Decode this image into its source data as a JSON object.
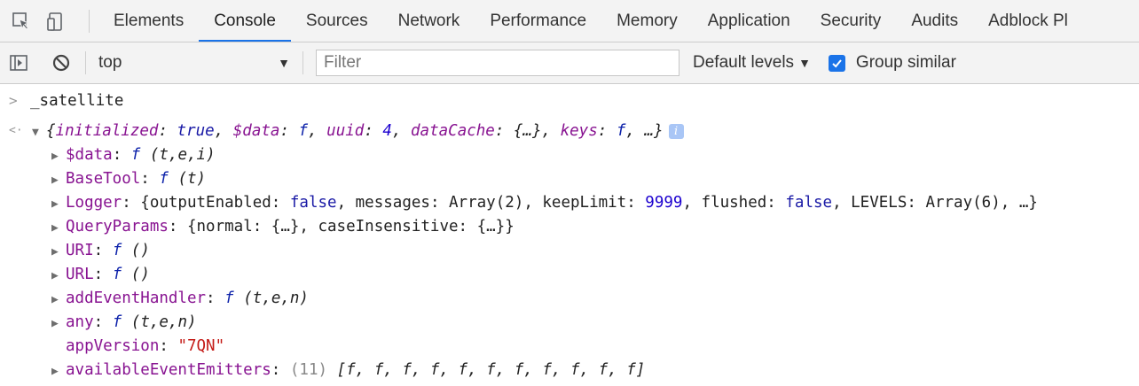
{
  "tabs": [
    {
      "label": "Elements"
    },
    {
      "label": "Console",
      "active": true
    },
    {
      "label": "Sources"
    },
    {
      "label": "Network"
    },
    {
      "label": "Performance"
    },
    {
      "label": "Memory"
    },
    {
      "label": "Application"
    },
    {
      "label": "Security"
    },
    {
      "label": "Audits"
    },
    {
      "label": "Adblock Pl"
    }
  ],
  "toolbar": {
    "context": "top",
    "filter_placeholder": "Filter",
    "levels_label": "Default levels",
    "group_similar_label": "Group similar",
    "group_similar_checked": true
  },
  "console": {
    "input_prompt": ">",
    "input_text": "_satellite",
    "result_prompt": "<·",
    "summary": {
      "open": "{",
      "k1": "initialized",
      "v1": "true",
      "k2": "$data",
      "v2": "f",
      "k3": "uuid",
      "v3": "4",
      "k4": "dataCache",
      "v4": "{…}",
      "k5": "keys",
      "v5": "f",
      "tail": "…}",
      "badge": "i"
    },
    "props": [
      {
        "key": "$data",
        "sig": "(t,e,i)"
      },
      {
        "key": "BaseTool",
        "sig": "(t)"
      },
      {
        "key": "Logger"
      },
      {
        "key": "QueryParams",
        "preview": "{normal: {…}, caseInsensitive: {…}}"
      },
      {
        "key": "URI",
        "sig": "()"
      },
      {
        "key": "URL",
        "sig": "()"
      },
      {
        "key": "addEventHandler",
        "sig": "(t,e,n)"
      },
      {
        "key": "any",
        "sig": "(t,e,n)"
      },
      {
        "key": "appVersion",
        "value": "\"7QN\""
      },
      {
        "key": "availableEventEmitters",
        "count": "(11)",
        "preview": "[f, f, f, f, f, f, f, f, f, f, f]"
      }
    ],
    "logger": {
      "k1": "outputEnabled",
      "v1": "false",
      "k2": "messages",
      "v2": "Array(2)",
      "k3": "keepLimit",
      "v3": "9999",
      "k4": "flushed",
      "v4": "false",
      "k5": "LEVELS",
      "v5": "Array(6)",
      "tail": "…}"
    },
    "f_glyph": "f"
  },
  "colors": {
    "accent": "#1a73e8",
    "key": "#881391",
    "string": "#c41a16",
    "keyword": "#1a1aa6"
  }
}
